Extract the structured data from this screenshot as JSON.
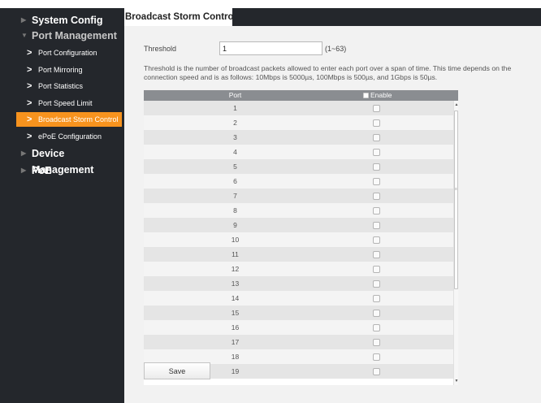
{
  "sidebar": {
    "items": [
      {
        "label": "System Config",
        "type": "top",
        "collapsed": true
      },
      {
        "label": "Port Management",
        "type": "top",
        "expanded": true
      },
      {
        "label": "Port Configuration",
        "type": "sub"
      },
      {
        "label": "Port Mirroring",
        "type": "sub"
      },
      {
        "label": "Port Statistics",
        "type": "sub"
      },
      {
        "label": "Port Speed Limit",
        "type": "sub"
      },
      {
        "label": "Broadcast Storm Control",
        "type": "sub",
        "active": true
      },
      {
        "label": "ePoE Configuration",
        "type": "sub"
      },
      {
        "label": "Device Management",
        "type": "top",
        "collapsed": true
      },
      {
        "label": "PoE",
        "type": "top",
        "collapsed": true
      }
    ]
  },
  "tab": {
    "title": "Broadcast Storm Control"
  },
  "threshold": {
    "label": "Threshold",
    "value": "1",
    "range": "(1~63)",
    "description": "Threshold is the number of broadcast packets allowed to enter each port over a span of time. This time depends on the connection speed and is as follows: 10Mbps is 5000µs, 100Mbps is 500µs, and 1Gbps is 50µs."
  },
  "table": {
    "col_port": "Port",
    "col_enable": "Enable",
    "rows": [
      "1",
      "2",
      "3",
      "4",
      "5",
      "6",
      "7",
      "8",
      "9",
      "10",
      "11",
      "12",
      "13",
      "14",
      "15",
      "16",
      "17",
      "18",
      "19"
    ]
  },
  "buttons": {
    "save": "Save"
  },
  "colors": {
    "accent": "#f7931e",
    "sidebar_bg": "#24272c",
    "header_bg": "#8a8d91"
  }
}
